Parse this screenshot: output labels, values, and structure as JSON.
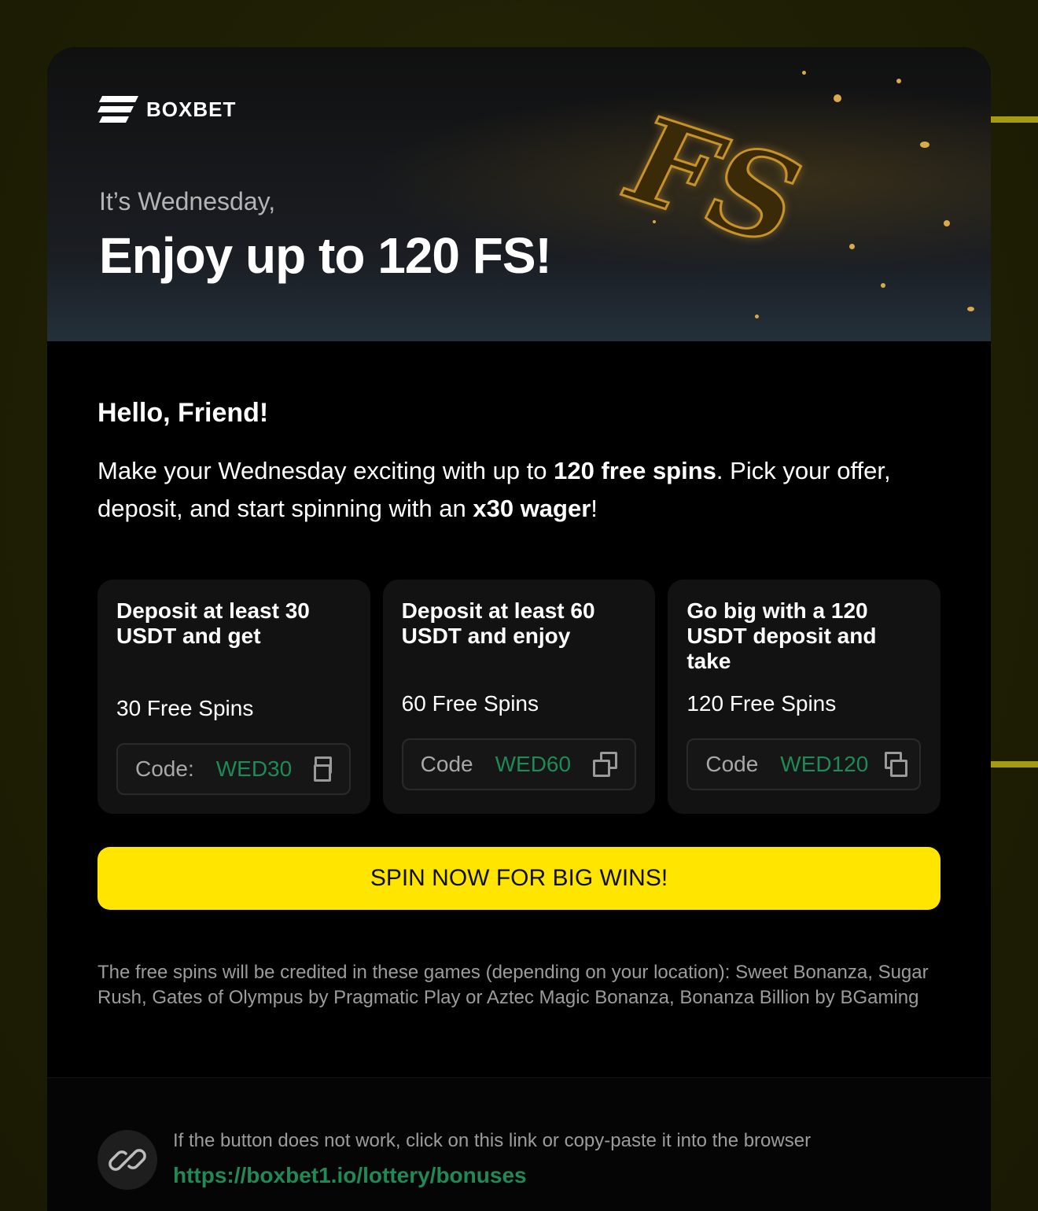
{
  "brand": {
    "name": "BOXBET"
  },
  "hero": {
    "eyebrow": "It’s Wednesday,",
    "title": "Enjoy up to 120 FS!",
    "art_text": "FS"
  },
  "greeting": "Hello, Friend!",
  "intro": {
    "part1": "Make your Wednesday exciting with up to ",
    "bold1": "120 free spins",
    "part2": ". Pick your offer, deposit, and start spinning with an ",
    "bold2": "x30 wager",
    "part3": "!"
  },
  "offers": [
    {
      "title": "Deposit at least 30 USDT and get",
      "spins": "30 Free Spins",
      "code_label": "Code:",
      "code": "WED30"
    },
    {
      "title": "Deposit at least 60 USDT and enjoy",
      "spins": "60 Free Spins",
      "code_label": "Code",
      "code": "WED60"
    },
    {
      "title": "Go big with a 120 USDT deposit and take",
      "spins": "120 Free Spins",
      "code_label": "Code",
      "code": "WED120"
    }
  ],
  "cta": {
    "label": "SPIN NOW FOR BIG WINS!"
  },
  "note": "The free spins will be credited in these games (depending on your location): Sweet Bonanza, Sugar Rush, Gates of Olympus by Pragmatic Play or Aztec Magic Bonanza, Bonanza Billion by BGaming",
  "footer": {
    "text": "If the button does not work, click on this link or copy-paste it into the browser",
    "link": "https://boxbet1.io/lottery/bonuses"
  },
  "colors": {
    "accent_yellow": "#ffe500",
    "code_green": "#1f8a55",
    "page_background": "#1f1f05"
  }
}
